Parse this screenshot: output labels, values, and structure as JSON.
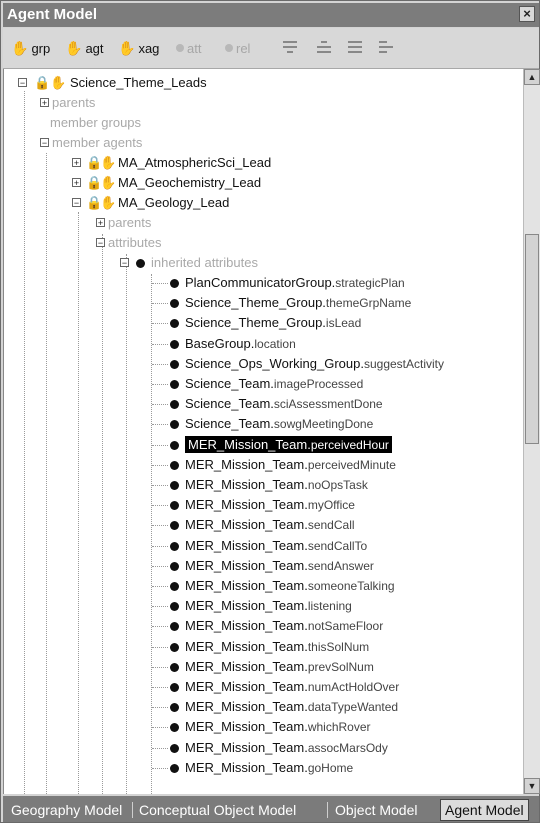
{
  "window": {
    "title": "Agent Model",
    "close": "×"
  },
  "toolbar": {
    "grp": "grp",
    "agt": "agt",
    "xag": "xag",
    "att": "att",
    "rel": "rel"
  },
  "tree": {
    "root": "Science_Theme_Leads",
    "parents": "parents",
    "member_groups": "member groups",
    "member_agents": "member agents",
    "agent1": "MA_AtmosphericSci_Lead",
    "agent2": "MA_Geochemistry_Lead",
    "agent3": "MA_Geology_Lead",
    "sub_parents": "parents",
    "attributes": "attributes",
    "inherited": "inherited attributes",
    "items": [
      {
        "prefix": "PlanCommunicatorGroup.",
        "field": "strategicPlan"
      },
      {
        "prefix": "Science_Theme_Group.",
        "field": "themeGrpName"
      },
      {
        "prefix": "Science_Theme_Group.",
        "field": "isLead"
      },
      {
        "prefix": "BaseGroup.",
        "field": "location"
      },
      {
        "prefix": "Science_Ops_Working_Group.",
        "field": "suggestActivity"
      },
      {
        "prefix": "Science_Team.",
        "field": "imageProcessed"
      },
      {
        "prefix": "Science_Team.",
        "field": "sciAssessmentDone"
      },
      {
        "prefix": "Science_Team.",
        "field": "sowgMeetingDone"
      },
      {
        "prefix": "MER_Mission_Team.",
        "field": "perceivedHour"
      },
      {
        "prefix": "MER_Mission_Team.",
        "field": "perceivedMinute"
      },
      {
        "prefix": "MER_Mission_Team.",
        "field": "noOpsTask"
      },
      {
        "prefix": "MER_Mission_Team.",
        "field": "myOffice"
      },
      {
        "prefix": "MER_Mission_Team.",
        "field": "sendCall"
      },
      {
        "prefix": "MER_Mission_Team.",
        "field": "sendCallTo"
      },
      {
        "prefix": "MER_Mission_Team.",
        "field": "sendAnswer"
      },
      {
        "prefix": "MER_Mission_Team.",
        "field": "someoneTalking"
      },
      {
        "prefix": "MER_Mission_Team.",
        "field": "listening"
      },
      {
        "prefix": "MER_Mission_Team.",
        "field": "notSameFloor"
      },
      {
        "prefix": "MER_Mission_Team.",
        "field": "thisSolNum"
      },
      {
        "prefix": "MER_Mission_Team.",
        "field": "prevSolNum"
      },
      {
        "prefix": "MER_Mission_Team.",
        "field": "numActHoldOver"
      },
      {
        "prefix": "MER_Mission_Team.",
        "field": "dataTypeWanted"
      },
      {
        "prefix": "MER_Mission_Team.",
        "field": "whichRover"
      },
      {
        "prefix": "MER_Mission_Team.",
        "field": "assocMarsOdy"
      },
      {
        "prefix": "MER_Mission_Team.",
        "field": "goHome"
      }
    ]
  },
  "tabs": [
    "Geography Model",
    "Conceptual Object Model",
    "Object Model",
    "Agent Model"
  ],
  "selected_tab": "Agent Model",
  "selected_item": "MER_Mission_Team.perceivedHour"
}
